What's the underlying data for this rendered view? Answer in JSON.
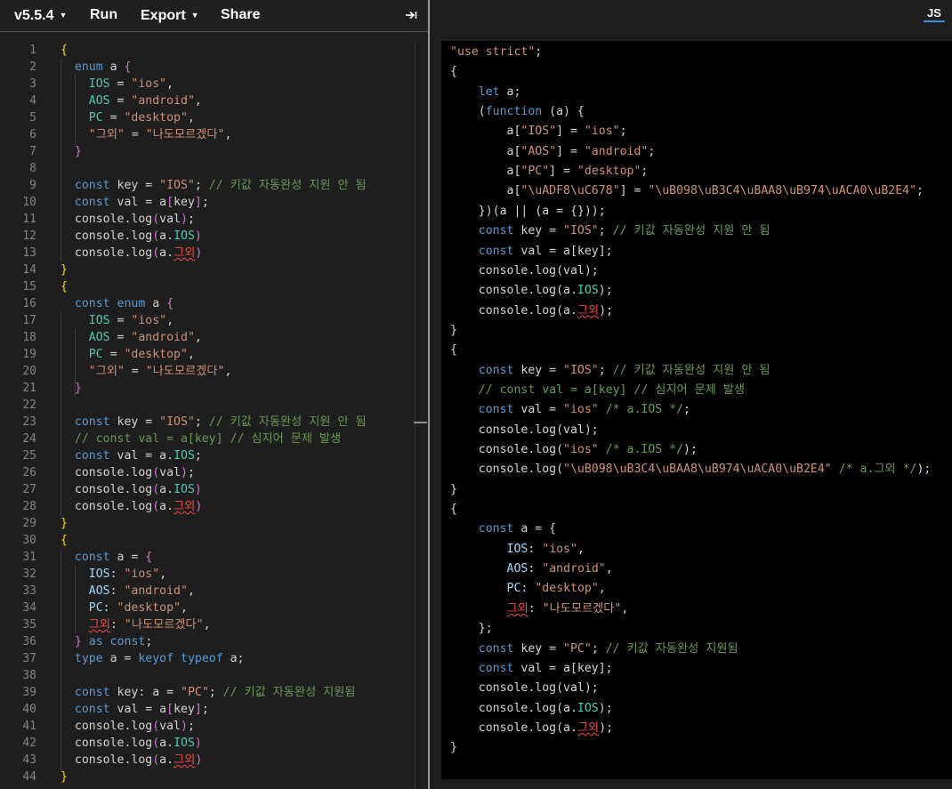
{
  "toolbar": {
    "version_label": "v5.5.4",
    "run_label": "Run",
    "export_label": "Export",
    "share_label": "Share",
    "collapse_icon": "collapse-right-icon"
  },
  "output_tab": {
    "label": "JS"
  },
  "editor": {
    "language": "TypeScript",
    "lines": [
      [
        [
          "{",
          "b1"
        ]
      ],
      [
        [
          "  ",
          ""
        ],
        [
          "enum",
          "kw"
        ],
        [
          " a ",
          ""
        ],
        [
          "{",
          "b2"
        ]
      ],
      [
        [
          "    ",
          ""
        ],
        [
          "IOS",
          "enm"
        ],
        [
          " = ",
          ""
        ],
        [
          "\"ios\"",
          "str"
        ],
        [
          ",",
          ""
        ]
      ],
      [
        [
          "    ",
          ""
        ],
        [
          "AOS",
          "enm"
        ],
        [
          " = ",
          ""
        ],
        [
          "\"android\"",
          "str"
        ],
        [
          ",",
          ""
        ]
      ],
      [
        [
          "    ",
          ""
        ],
        [
          "PC",
          "enm"
        ],
        [
          " = ",
          ""
        ],
        [
          "\"desktop\"",
          "str"
        ],
        [
          ",",
          ""
        ]
      ],
      [
        [
          "    ",
          ""
        ],
        [
          "\"그외\"",
          "str"
        ],
        [
          " = ",
          ""
        ],
        [
          "\"나도모르겠다\"",
          "str"
        ],
        [
          ",",
          ""
        ]
      ],
      [
        [
          "  ",
          ""
        ],
        [
          "}",
          "b2"
        ]
      ],
      [],
      [
        [
          "  ",
          ""
        ],
        [
          "const",
          "kw"
        ],
        [
          " key = ",
          ""
        ],
        [
          "\"IOS\"",
          "str"
        ],
        [
          "; ",
          ""
        ],
        [
          "// 키값 자동완성 지원 안 됨",
          "cmt"
        ]
      ],
      [
        [
          "  ",
          ""
        ],
        [
          "const",
          "kw"
        ],
        [
          " val = a",
          ""
        ],
        [
          "[",
          "b2"
        ],
        [
          "key",
          ""
        ],
        [
          "]",
          "b2"
        ],
        [
          ";",
          ""
        ]
      ],
      [
        [
          "  console.log",
          ""
        ],
        [
          "(",
          "b2"
        ],
        [
          "val",
          ""
        ],
        [
          ")",
          "b2"
        ],
        [
          ";",
          ""
        ]
      ],
      [
        [
          "  console.log",
          ""
        ],
        [
          "(",
          "b2"
        ],
        [
          "a.",
          ""
        ],
        [
          "IOS",
          "enm"
        ],
        [
          ")",
          "b2"
        ]
      ],
      [
        [
          "  console.log",
          ""
        ],
        [
          "(",
          "b2"
        ],
        [
          "a.",
          ""
        ],
        [
          "그외",
          "red"
        ],
        [
          ")",
          "b2"
        ]
      ],
      [
        [
          "}",
          "b1"
        ]
      ],
      [
        [
          "{",
          "b1"
        ]
      ],
      [
        [
          "  ",
          ""
        ],
        [
          "const",
          "kw"
        ],
        [
          " ",
          ""
        ],
        [
          "enum",
          "kw"
        ],
        [
          " a ",
          ""
        ],
        [
          "{",
          "b2"
        ]
      ],
      [
        [
          "    ",
          ""
        ],
        [
          "IOS",
          "enm"
        ],
        [
          " = ",
          ""
        ],
        [
          "\"ios\"",
          "str"
        ],
        [
          ",",
          ""
        ]
      ],
      [
        [
          "    ",
          ""
        ],
        [
          "AOS",
          "enm"
        ],
        [
          " = ",
          ""
        ],
        [
          "\"android\"",
          "str"
        ],
        [
          ",",
          ""
        ]
      ],
      [
        [
          "    ",
          ""
        ],
        [
          "PC",
          "enm"
        ],
        [
          " = ",
          ""
        ],
        [
          "\"desktop\"",
          "str"
        ],
        [
          ",",
          ""
        ]
      ],
      [
        [
          "    ",
          ""
        ],
        [
          "\"그외\"",
          "str"
        ],
        [
          " = ",
          ""
        ],
        [
          "\"나도모르겠다\"",
          "str"
        ],
        [
          ",",
          ""
        ]
      ],
      [
        [
          "  ",
          ""
        ],
        [
          "}",
          "b2"
        ]
      ],
      [],
      [
        [
          "  ",
          ""
        ],
        [
          "const",
          "kw"
        ],
        [
          " key = ",
          ""
        ],
        [
          "\"IOS\"",
          "str"
        ],
        [
          "; ",
          ""
        ],
        [
          "// 키값 자동완성 지원 안 됨",
          "cmt"
        ]
      ],
      [
        [
          "  ",
          ""
        ],
        [
          "// const val = a[key] // 심지어 문제 발생",
          "cmt"
        ]
      ],
      [
        [
          "  ",
          ""
        ],
        [
          "const",
          "kw"
        ],
        [
          " val = a.",
          ""
        ],
        [
          "IOS",
          "enm"
        ],
        [
          ";",
          ""
        ]
      ],
      [
        [
          "  console.log",
          ""
        ],
        [
          "(",
          "b2"
        ],
        [
          "val",
          ""
        ],
        [
          ")",
          "b2"
        ],
        [
          ";",
          ""
        ]
      ],
      [
        [
          "  console.log",
          ""
        ],
        [
          "(",
          "b2"
        ],
        [
          "a.",
          ""
        ],
        [
          "IOS",
          "enm"
        ],
        [
          ")",
          "b2"
        ]
      ],
      [
        [
          "  console.log",
          ""
        ],
        [
          "(",
          "b2"
        ],
        [
          "a.",
          ""
        ],
        [
          "그외",
          "red"
        ],
        [
          ")",
          "b2"
        ]
      ],
      [
        [
          "}",
          "b1"
        ]
      ],
      [
        [
          "{",
          "b1"
        ]
      ],
      [
        [
          "  ",
          ""
        ],
        [
          "const",
          "kw"
        ],
        [
          " a = ",
          ""
        ],
        [
          "{",
          "b2"
        ]
      ],
      [
        [
          "    ",
          ""
        ],
        [
          "IOS",
          "prop"
        ],
        [
          ": ",
          ""
        ],
        [
          "\"ios\"",
          "str"
        ],
        [
          ",",
          ""
        ]
      ],
      [
        [
          "    ",
          ""
        ],
        [
          "AOS",
          "prop"
        ],
        [
          ": ",
          ""
        ],
        [
          "\"android\"",
          "str"
        ],
        [
          ",",
          ""
        ]
      ],
      [
        [
          "    ",
          ""
        ],
        [
          "PC",
          "prop"
        ],
        [
          ": ",
          ""
        ],
        [
          "\"desktop\"",
          "str"
        ],
        [
          ",",
          ""
        ]
      ],
      [
        [
          "    ",
          ""
        ],
        [
          "그외",
          "red"
        ],
        [
          ": ",
          ""
        ],
        [
          "\"나도모르겠다\"",
          "str"
        ],
        [
          ",",
          ""
        ]
      ],
      [
        [
          "  ",
          ""
        ],
        [
          "}",
          "b2"
        ],
        [
          " ",
          ""
        ],
        [
          "as",
          "kw"
        ],
        [
          " ",
          ""
        ],
        [
          "const",
          "kw"
        ],
        [
          ";",
          ""
        ]
      ],
      [
        [
          "  ",
          ""
        ],
        [
          "type",
          "kw"
        ],
        [
          " a = ",
          ""
        ],
        [
          "keyof",
          "kw"
        ],
        [
          " ",
          ""
        ],
        [
          "typeof",
          "kw"
        ],
        [
          " a;",
          ""
        ]
      ],
      [],
      [
        [
          "  ",
          ""
        ],
        [
          "const",
          "kw"
        ],
        [
          " key: a = ",
          ""
        ],
        [
          "\"PC\"",
          "str"
        ],
        [
          "; ",
          ""
        ],
        [
          "// 키값 자동완성 지원됨",
          "cmt"
        ]
      ],
      [
        [
          "  ",
          ""
        ],
        [
          "const",
          "kw"
        ],
        [
          " val = a",
          ""
        ],
        [
          "[",
          "b2"
        ],
        [
          "key",
          ""
        ],
        [
          "]",
          "b2"
        ],
        [
          ";",
          ""
        ]
      ],
      [
        [
          "  console.log",
          ""
        ],
        [
          "(",
          "b2"
        ],
        [
          "val",
          ""
        ],
        [
          ")",
          "b2"
        ],
        [
          ";",
          ""
        ]
      ],
      [
        [
          "  console.log",
          ""
        ],
        [
          "(",
          "b2"
        ],
        [
          "a.",
          ""
        ],
        [
          "IOS",
          "enm"
        ],
        [
          ")",
          "b2"
        ]
      ],
      [
        [
          "  console.log",
          ""
        ],
        [
          "(",
          "b2"
        ],
        [
          "a.",
          ""
        ],
        [
          "그외",
          "red"
        ],
        [
          ")",
          "b2"
        ]
      ],
      [
        [
          "}",
          "b1"
        ]
      ]
    ]
  },
  "output": {
    "lines": [
      [
        [
          "\"use strict\"",
          "str"
        ],
        [
          ";",
          ""
        ]
      ],
      [
        [
          "{",
          ""
        ]
      ],
      [
        [
          "    ",
          ""
        ],
        [
          "let",
          "kw"
        ],
        [
          " a;",
          ""
        ]
      ],
      [
        [
          "    (",
          ""
        ],
        [
          "function",
          "kw"
        ],
        [
          " (a) {",
          ""
        ]
      ],
      [
        [
          "        a[",
          ""
        ],
        [
          "\"IOS\"",
          "str"
        ],
        [
          "] = ",
          ""
        ],
        [
          "\"ios\"",
          "str"
        ],
        [
          ";",
          ""
        ]
      ],
      [
        [
          "        a[",
          ""
        ],
        [
          "\"AOS\"",
          "str"
        ],
        [
          "] = ",
          ""
        ],
        [
          "\"android\"",
          "str"
        ],
        [
          ";",
          ""
        ]
      ],
      [
        [
          "        a[",
          ""
        ],
        [
          "\"PC\"",
          "str"
        ],
        [
          "] = ",
          ""
        ],
        [
          "\"desktop\"",
          "str"
        ],
        [
          ";",
          ""
        ]
      ],
      [
        [
          "        a[",
          ""
        ],
        [
          "\"\\uADF8\\uC678\"",
          "str"
        ],
        [
          "] = ",
          ""
        ],
        [
          "\"\\uB098\\uB3C4\\uBAA8\\uB974\\uACA0\\uB2E4\"",
          "str"
        ],
        [
          ";",
          ""
        ]
      ],
      [
        [
          "    })(a || (a = {}));",
          ""
        ]
      ],
      [
        [
          "    ",
          ""
        ],
        [
          "const",
          "kw"
        ],
        [
          " key = ",
          ""
        ],
        [
          "\"IOS\"",
          "str"
        ],
        [
          "; ",
          ""
        ],
        [
          "// 키값 자동완성 지원 안 됨",
          "cmt"
        ]
      ],
      [
        [
          "    ",
          ""
        ],
        [
          "const",
          "kw"
        ],
        [
          " val = a[key];",
          ""
        ]
      ],
      [
        [
          "    console.log(val);",
          ""
        ]
      ],
      [
        [
          "    console.log(a.",
          ""
        ],
        [
          "IOS",
          "enm"
        ],
        [
          ");",
          ""
        ]
      ],
      [
        [
          "    console.log(a.",
          ""
        ],
        [
          "그외",
          "red"
        ],
        [
          ");",
          ""
        ]
      ],
      [
        [
          "}",
          ""
        ]
      ],
      [
        [
          "{",
          ""
        ]
      ],
      [
        [
          "    ",
          ""
        ],
        [
          "const",
          "kw"
        ],
        [
          " key = ",
          ""
        ],
        [
          "\"IOS\"",
          "str"
        ],
        [
          "; ",
          ""
        ],
        [
          "// 키값 자동완성 지원 안 됨",
          "cmt"
        ]
      ],
      [
        [
          "    ",
          ""
        ],
        [
          "// const val = a[key] // 심지어 문제 발생",
          "cmt"
        ]
      ],
      [
        [
          "    ",
          ""
        ],
        [
          "const",
          "kw"
        ],
        [
          " val = ",
          ""
        ],
        [
          "\"ios\"",
          "str"
        ],
        [
          " ",
          ""
        ],
        [
          "/* a.IOS */",
          "cmt"
        ],
        [
          ";",
          ""
        ]
      ],
      [
        [
          "    console.log(val);",
          ""
        ]
      ],
      [
        [
          "    console.log(",
          ""
        ],
        [
          "\"ios\"",
          "str"
        ],
        [
          " ",
          ""
        ],
        [
          "/* a.IOS */",
          "cmt"
        ],
        [
          ");",
          ""
        ]
      ],
      [
        [
          "    console.log(",
          ""
        ],
        [
          "\"\\uB098\\uB3C4\\uBAA8\\uB974\\uACA0\\uB2E4\"",
          "str"
        ],
        [
          " ",
          ""
        ],
        [
          "/* a.그외 */",
          "cmt"
        ],
        [
          ");",
          ""
        ]
      ],
      [
        [
          "}",
          ""
        ]
      ],
      [
        [
          "{",
          ""
        ]
      ],
      [
        [
          "    ",
          ""
        ],
        [
          "const",
          "kw"
        ],
        [
          " a = {",
          ""
        ]
      ],
      [
        [
          "        ",
          ""
        ],
        [
          "IOS",
          "prop"
        ],
        [
          ": ",
          ""
        ],
        [
          "\"ios\"",
          "str"
        ],
        [
          ",",
          ""
        ]
      ],
      [
        [
          "        ",
          ""
        ],
        [
          "AOS",
          "prop"
        ],
        [
          ": ",
          ""
        ],
        [
          "\"android\"",
          "str"
        ],
        [
          ",",
          ""
        ]
      ],
      [
        [
          "        ",
          ""
        ],
        [
          "PC",
          "prop"
        ],
        [
          ": ",
          ""
        ],
        [
          "\"desktop\"",
          "str"
        ],
        [
          ",",
          ""
        ]
      ],
      [
        [
          "        ",
          ""
        ],
        [
          "그외",
          "red"
        ],
        [
          ": ",
          ""
        ],
        [
          "\"나도모르겠다\"",
          "str"
        ],
        [
          ",",
          ""
        ]
      ],
      [
        [
          "    };",
          ""
        ]
      ],
      [
        [
          "    ",
          ""
        ],
        [
          "const",
          "kw"
        ],
        [
          " key = ",
          ""
        ],
        [
          "\"PC\"",
          "str"
        ],
        [
          "; ",
          ""
        ],
        [
          "// 키값 자동완성 지원됨",
          "cmt"
        ]
      ],
      [
        [
          "    ",
          ""
        ],
        [
          "const",
          "kw"
        ],
        [
          " val = a[key];",
          ""
        ]
      ],
      [
        [
          "    console.log(val);",
          ""
        ]
      ],
      [
        [
          "    console.log(a.",
          ""
        ],
        [
          "IOS",
          "enm"
        ],
        [
          ");",
          ""
        ]
      ],
      [
        [
          "    console.log(a.",
          ""
        ],
        [
          "그외",
          "red"
        ],
        [
          ");",
          ""
        ]
      ],
      [
        [
          "}",
          ""
        ]
      ]
    ]
  }
}
